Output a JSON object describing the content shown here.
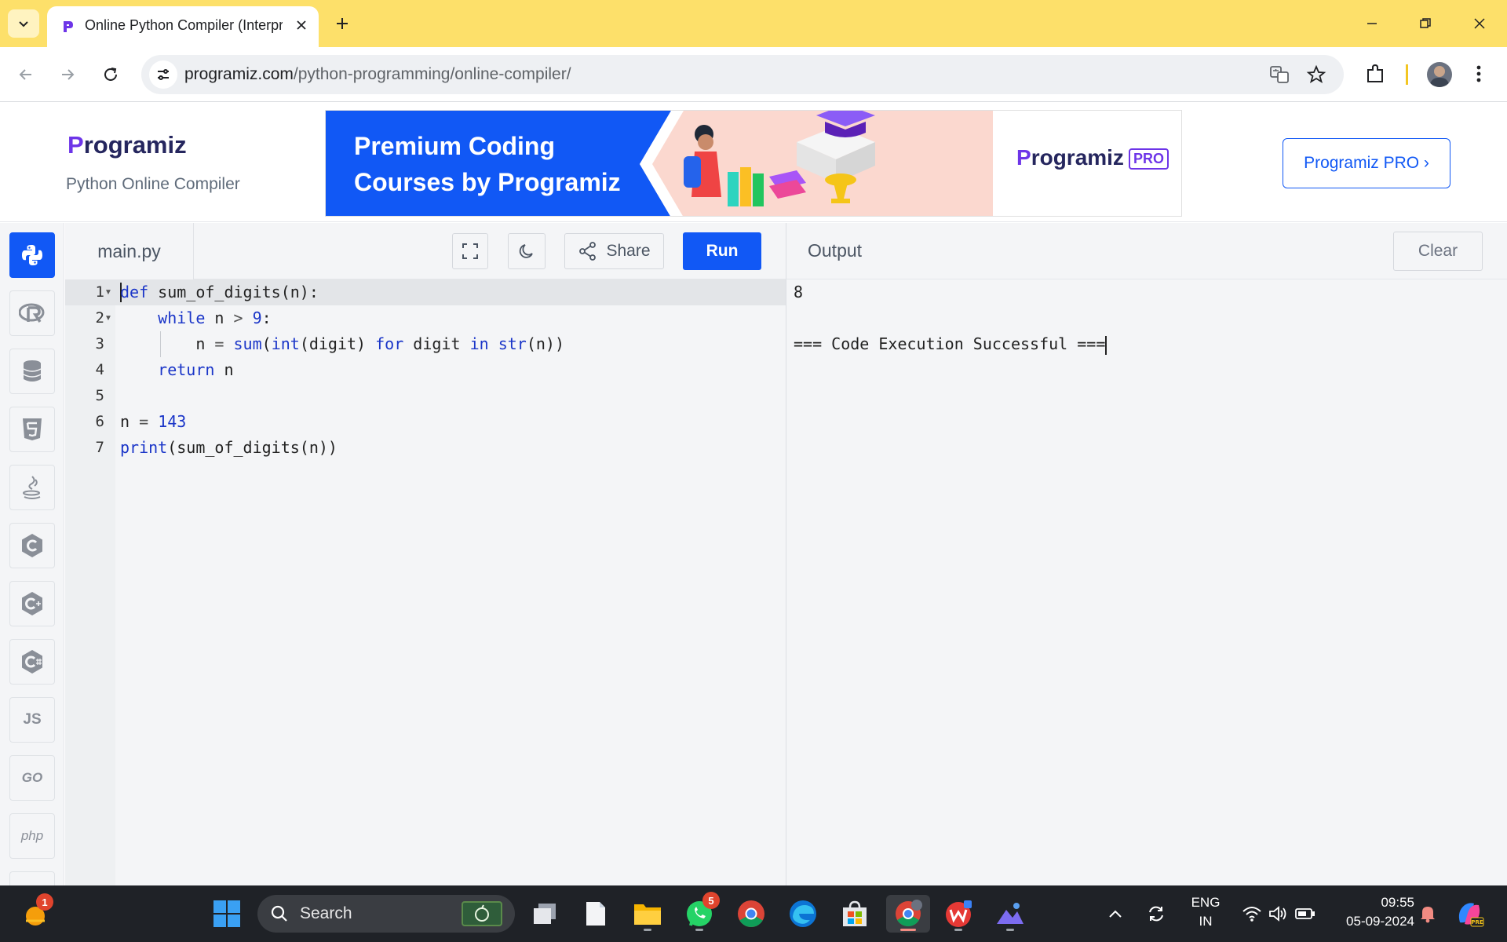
{
  "browser": {
    "tab_title": "Online Python Compiler (Interpreter)",
    "url_host": "programiz.com",
    "url_path": "/python-programming/online-compiler/"
  },
  "header": {
    "logo_text": "rogramiz",
    "logo_initial": "P",
    "subtitle": "Python Online Compiler",
    "banner_line1": "Premium Coding",
    "banner_line2": "Courses by Programiz",
    "banner_logo": "rogramiz",
    "banner_logo_initial": "P",
    "banner_pro": "PRO",
    "pro_button": "Programiz PRO ›"
  },
  "sidebar": {
    "languages": [
      "python",
      "r",
      "sql",
      "html",
      "java",
      "c",
      "cpp",
      "csharp",
      "js",
      "go",
      "php"
    ],
    "js_label": "JS",
    "go_label": "GO",
    "php_label": "php"
  },
  "editor": {
    "file_name": "main.py",
    "share_label": "Share",
    "run_label": "Run",
    "line_numbers": [
      "1",
      "2",
      "3",
      "4",
      "5",
      "6",
      "7"
    ],
    "lines": [
      "def sum_of_digits(n):",
      "    while n > 9:",
      "        n = sum(int(digit) for digit in str(n))",
      "    return n",
      "",
      "n = 143",
      "print(sum_of_digits(n))"
    ]
  },
  "output": {
    "title": "Output",
    "clear_label": "Clear",
    "lines": [
      "8",
      "",
      "=== Code Execution Successful ==="
    ]
  },
  "taskbar": {
    "search_label": "Search",
    "widgets_badge": "1",
    "whatsapp_badge": "5",
    "lang_line1": "ENG",
    "lang_line2": "IN",
    "time": "09:55",
    "date": "05-09-2024"
  },
  "colors": {
    "accent": "#1158f5",
    "tabbar": "#fde06a",
    "keyword": "#1a35c8"
  }
}
